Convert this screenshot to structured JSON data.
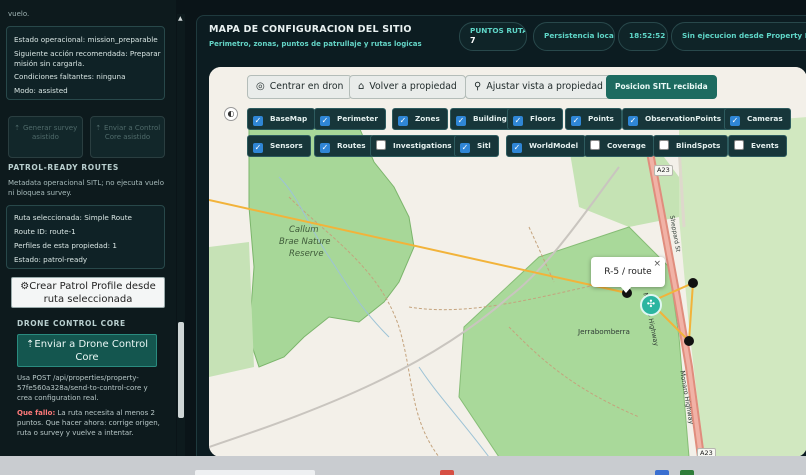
{
  "left_panel": {
    "cut_text": "vuelo.",
    "status_card": [
      "Estado operacional: mission_preparable",
      "Siguiente acción recomendada: Preparar misión sin cargarla.",
      "Condiciones faltantes: ninguna",
      "Modo: assisted"
    ],
    "btn_generate": "Generar survey asistido",
    "btn_send_control": "Enviar a Control Core asistido",
    "patrol_title": "PATROL-READY ROUTES",
    "patrol_desc": "Metadata operacional SITL; no ejecuta vuelo ni bloquea survey.",
    "route_card": [
      "Ruta seleccionada: Simple Route",
      "Route ID: route-1",
      "Perfiles de esta propiedad: 1",
      "Estado: patrol-ready"
    ],
    "patrol_btn": "Crear Patrol Profile desde ruta seleccionada",
    "drone_title": "DRONE CONTROL CORE",
    "drone_btn": "Enviar a Drone Control Core",
    "post_text": "Usa POST /api/properties/property-57fe560a328a/send-to-control-core y crea configuration real.",
    "error_label": "Que fallo:",
    "error_text": "La ruta necesita al menos 2 puntos. Que hacer ahora: corrige origen, ruta o survey y vuelve a intentar."
  },
  "header": {
    "title": "MAPA DE CONFIGURACION DEL SITIO",
    "subtitle": "Perimetro, zonas, puntos de patrullaje y rutas logicas",
    "pills": {
      "route_points_label": "PUNTOS RUTA",
      "route_points_value": "7",
      "persistence": "Persistencia local",
      "clock": "18:52:52",
      "execution": "Sin ejecucion desde Property Mapper"
    }
  },
  "map": {
    "buttons": {
      "center_drone": "Centrar en dron",
      "back_property": "Volver a propiedad",
      "fit_property": "Ajustar vista a propiedad",
      "sitl": "Posicion SITL recibida"
    },
    "layers_row1": [
      {
        "label": "BaseMap",
        "checked": true
      },
      {
        "label": "Perimeter",
        "checked": true
      },
      {
        "label": "Zones",
        "checked": true
      },
      {
        "label": "Buildings",
        "checked": true
      },
      {
        "label": "Floors",
        "checked": true
      },
      {
        "label": "Points",
        "checked": true
      },
      {
        "label": "ObservationPoints",
        "checked": true
      },
      {
        "label": "Cameras",
        "checked": true
      }
    ],
    "layers_row2": [
      {
        "label": "Sensors",
        "checked": true
      },
      {
        "label": "Routes",
        "checked": true
      },
      {
        "label": "Investigations",
        "checked": false
      },
      {
        "label": "Sitl",
        "checked": true
      },
      {
        "label": "WorldModel",
        "checked": true
      },
      {
        "label": "Coverage",
        "checked": false
      },
      {
        "label": "BlindSpots",
        "checked": false
      },
      {
        "label": "Events",
        "checked": false
      }
    ],
    "place_label_1": "Callum",
    "place_label_2": "Brae Nature",
    "place_label_3": "Reserve",
    "suburb_label": "Jerrabomberra",
    "road_a23_top": "A23",
    "road_a23_bottom": "A23",
    "road_name_1": "Monaro Highway",
    "road_name_2": "Monaro Highway",
    "road_name_3": "Sheppard St",
    "popup_text": "R-5 / route",
    "popup_close": "×",
    "zoom_symbol": "◐",
    "drone_symbol": "✣",
    "colors": {
      "route_line": "#f2b33a",
      "park": "#a9d99a",
      "road": "#e07d6e",
      "accent": "#2bb5a0"
    }
  }
}
